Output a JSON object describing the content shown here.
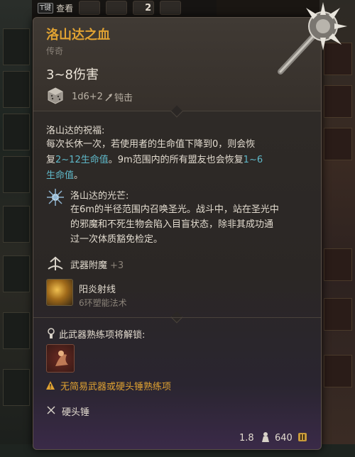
{
  "topbar": {
    "key_label": "T键",
    "action_label": "查看",
    "count": "2"
  },
  "item": {
    "name": "洛山达之血",
    "rarity": "传奇",
    "damage": "3~8伤害",
    "dice": "1d6+2",
    "damage_type": "钝击"
  },
  "blessing": {
    "title": "洛山达的祝福:",
    "line1": "每次长休一次，若使用者的生命值下降到0，则会恢",
    "line2_pre": "复",
    "line2_hl": "2~12生命值",
    "line2_mid": "。9m范围内的所有盟友也会恢复",
    "line2_hl2": "1~6",
    "line3_hl": "生命值",
    "line3_post": "。"
  },
  "radiance": {
    "title": "洛山达的光芒:",
    "line1": "在6m的半径范围内召唤圣光。战斗中，站在圣光中",
    "line2": "的邪魔和不死生物会陷入目盲状态，除非其成功通",
    "line3": "过一次体质豁免检定。"
  },
  "enchant": {
    "label": "武器附魔",
    "bonus": "+3"
  },
  "spell": {
    "name": "阳炎射线",
    "subtitle": "6环塑能法术"
  },
  "proficiency": {
    "unlock_label": "此武器熟练项将解锁:",
    "warning": "无简易武器或硬头锤熟练项",
    "weapon_type": "硬头锤"
  },
  "footer": {
    "weight": "1.8",
    "value": "640"
  },
  "colors": {
    "title_gold": "#e0a232",
    "highlight_cyan": "#5fb8c8",
    "text": "#e2dbcf",
    "muted": "#8a8278"
  }
}
